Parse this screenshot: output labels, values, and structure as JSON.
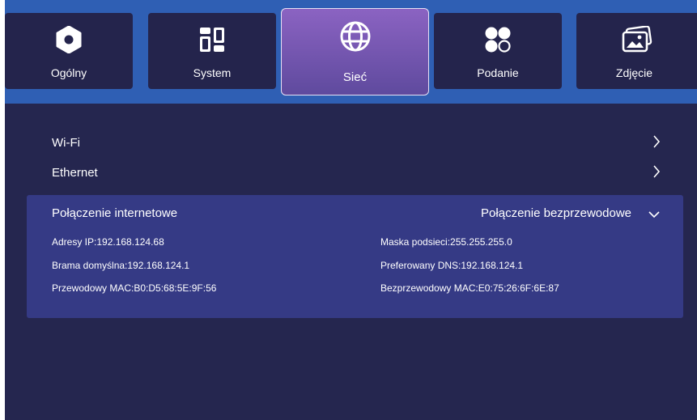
{
  "tabs": [
    {
      "label": "Ogólny",
      "icon": "gear-icon"
    },
    {
      "label": "System",
      "icon": "grid-icon"
    },
    {
      "label": "Sieć",
      "icon": "globe-icon",
      "active": true
    },
    {
      "label": "Podanie",
      "icon": "apps-icon"
    },
    {
      "label": "Zdjęcie",
      "icon": "image-icon"
    }
  ],
  "menu": {
    "wifi_label": "Wi-Fi",
    "ethernet_label": "Ethernet"
  },
  "connection": {
    "title": "Połączenie internetowe",
    "value": "Połączenie bezprzewodowe",
    "ip": "Adresy IP:192.168.124.68",
    "subnet": "Maska podsieci:255.255.255.0",
    "gateway": "Brama domyślna:192.168.124.1",
    "dns": "Preferowany DNS:192.168.124.1",
    "wired_mac": "Przewodowy MAC:B0:D5:68:5E:9F:56",
    "wireless_mac": "Bezprzewodowy MAC:E0:75:26:6F:6E:87"
  },
  "colors": {
    "background": "#25264f",
    "top_band": "#2f5fb4",
    "tab": "#24244c",
    "active_tab_top": "#8b63c2",
    "active_tab_bottom": "#5f4a9e",
    "panel": "#353a85"
  }
}
